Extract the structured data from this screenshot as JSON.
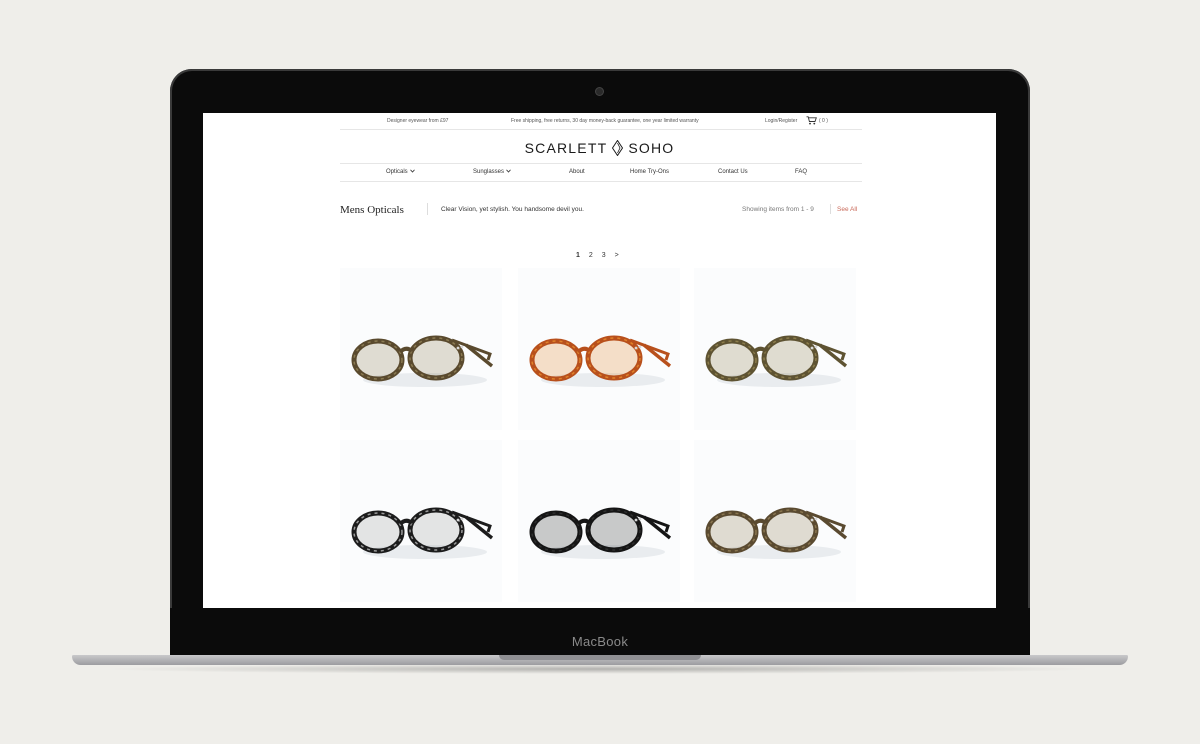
{
  "device": {
    "label": "MacBook"
  },
  "topbar": {
    "left_text": "Designer eyewear from £97",
    "promo_text": "Free shipping, free returns, 30 day money-back guarantee, one year limited warranty",
    "login_label": "Login/Register",
    "cart_count": "( 0 )"
  },
  "logo": {
    "left": "SCARLETT",
    "right": "SOHO"
  },
  "nav": {
    "opticals": "Opticals",
    "sunglasses": "Sunglasses",
    "about": "About",
    "home_try_ons": "Home Try-Ons",
    "contact": "Contact Us",
    "faq": "FAQ"
  },
  "page": {
    "title": "Mens Opticals",
    "tagline": "Clear Vision, yet stylish. You handsome devil you.",
    "showing": "Showing items from 1 - 9",
    "see_all": "See All"
  },
  "pagination": {
    "pages": [
      "1",
      "2",
      "3"
    ],
    "next": ">",
    "current": "1"
  },
  "products": [
    {
      "name": "tortoise-brown-glasses",
      "frame_color": "#5a4a2e",
      "accent_color": "#8a7a52"
    },
    {
      "name": "amber-red-glasses",
      "frame_color": "#b8501c",
      "accent_color": "#e0822a"
    },
    {
      "name": "olive-tortoise-glasses",
      "frame_color": "#5e5332",
      "accent_color": "#8c7d4c"
    },
    {
      "name": "black-fade-glasses",
      "frame_color": "#1c1c1c",
      "accent_color": "#9a9a9a"
    },
    {
      "name": "black-glasses",
      "frame_color": "#151515",
      "accent_color": "#2e2e2e"
    },
    {
      "name": "tortoise-olive-glasses",
      "frame_color": "#5a4a30",
      "accent_color": "#8a7650"
    }
  ]
}
